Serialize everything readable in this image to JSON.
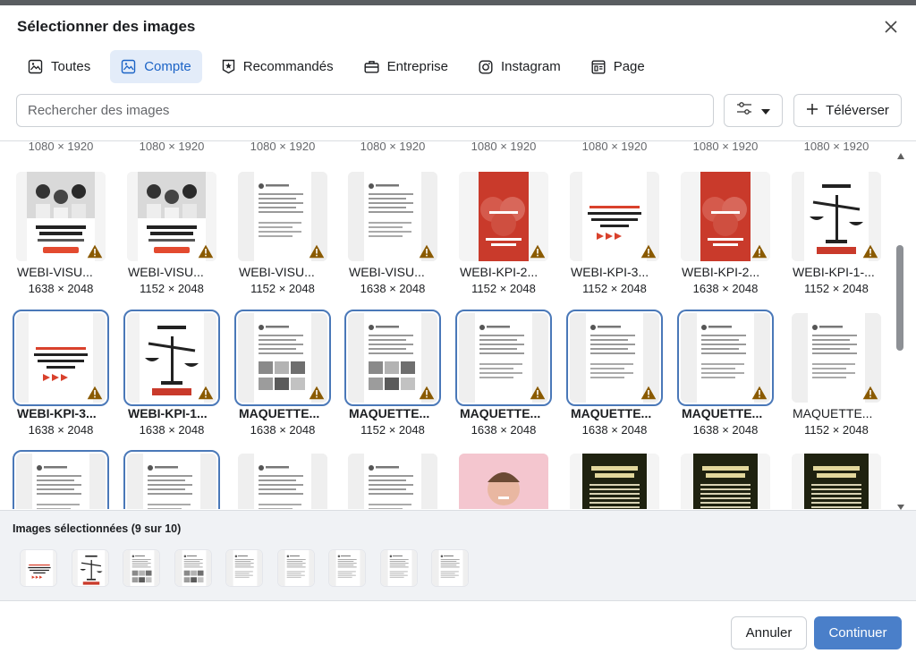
{
  "header": {
    "title": "Sélectionner des images"
  },
  "tabs": [
    {
      "label": "Toutes",
      "icon": "photos-icon",
      "active": false
    },
    {
      "label": "Compte",
      "icon": "photos-icon",
      "active": true
    },
    {
      "label": "Recommandés",
      "icon": "badge-icon",
      "active": false
    },
    {
      "label": "Entreprise",
      "icon": "briefcase-icon",
      "active": false
    },
    {
      "label": "Instagram",
      "icon": "instagram-icon",
      "active": false
    },
    {
      "label": "Page",
      "icon": "page-icon",
      "active": false
    }
  ],
  "search": {
    "placeholder": "Rechercher des images"
  },
  "toolbar": {
    "upload_label": "Téléverser"
  },
  "previous_row_dims": [
    "1080 × 1920",
    "1080 × 1920",
    "1080 × 1920",
    "1080 × 1920",
    "1080 × 1920",
    "1080 × 1920",
    "1080 × 1920",
    "1080 × 1920"
  ],
  "rows": [
    [
      {
        "name": "WEBI-VISU...",
        "dims": "1638 × 2048",
        "selected": false,
        "thumb": "photo-people"
      },
      {
        "name": "WEBI-VISU...",
        "dims": "1152 × 2048",
        "selected": false,
        "thumb": "photo-people"
      },
      {
        "name": "WEBI-VISU...",
        "dims": "1152 × 2048",
        "selected": false,
        "thumb": "post"
      },
      {
        "name": "WEBI-VISU...",
        "dims": "1638 × 2048",
        "selected": false,
        "thumb": "post"
      },
      {
        "name": "WEBI-KPI-2...",
        "dims": "1152 × 2048",
        "selected": false,
        "thumb": "red"
      },
      {
        "name": "WEBI-KPI-3...",
        "dims": "1152 × 2048",
        "selected": false,
        "thumb": "promo"
      },
      {
        "name": "WEBI-KPI-2...",
        "dims": "1638 × 2048",
        "selected": false,
        "thumb": "red"
      },
      {
        "name": "WEBI-KPI-1-...",
        "dims": "1152 × 2048",
        "selected": false,
        "thumb": "scale"
      }
    ],
    [
      {
        "name": "WEBI-KPI-3...",
        "dims": "1638 × 2048",
        "selected": true,
        "thumb": "promo"
      },
      {
        "name": "WEBI-KPI-1...",
        "dims": "1638 × 2048",
        "selected": true,
        "thumb": "scale"
      },
      {
        "name": "MAQUETTE...",
        "dims": "1638 × 2048",
        "selected": true,
        "thumb": "post-img"
      },
      {
        "name": "MAQUETTE...",
        "dims": "1152 × 2048",
        "selected": true,
        "thumb": "post-img"
      },
      {
        "name": "MAQUETTE...",
        "dims": "1638 × 2048",
        "selected": true,
        "thumb": "post"
      },
      {
        "name": "MAQUETTE...",
        "dims": "1638 × 2048",
        "selected": true,
        "thumb": "post"
      },
      {
        "name": "MAQUETTE...",
        "dims": "1638 × 2048",
        "selected": true,
        "thumb": "post"
      },
      {
        "name": "MAQUETTE...",
        "dims": "1152 × 2048",
        "selected": false,
        "thumb": "post"
      }
    ],
    [
      {
        "selected": true,
        "thumb": "post"
      },
      {
        "selected": true,
        "thumb": "post"
      },
      {
        "selected": false,
        "thumb": "post"
      },
      {
        "selected": false,
        "thumb": "post"
      },
      {
        "selected": false,
        "thumb": "portrait"
      },
      {
        "selected": false,
        "thumb": "book"
      },
      {
        "selected": false,
        "thumb": "book"
      },
      {
        "selected": false,
        "thumb": "book"
      }
    ]
  ],
  "selection": {
    "title": "Images sélectionnées (9 sur 10)",
    "items": [
      "promo",
      "scale",
      "post-img",
      "post-img",
      "post",
      "post",
      "post",
      "post",
      "post"
    ]
  },
  "actions": {
    "cancel_label": "Annuler",
    "continue_label": "Continuer"
  },
  "colors": {
    "accent": "#4a7fc9",
    "active_tab_bg": "#e3ecf9",
    "selected_outline": "#4a78b8",
    "warning": "#8a5a00"
  }
}
